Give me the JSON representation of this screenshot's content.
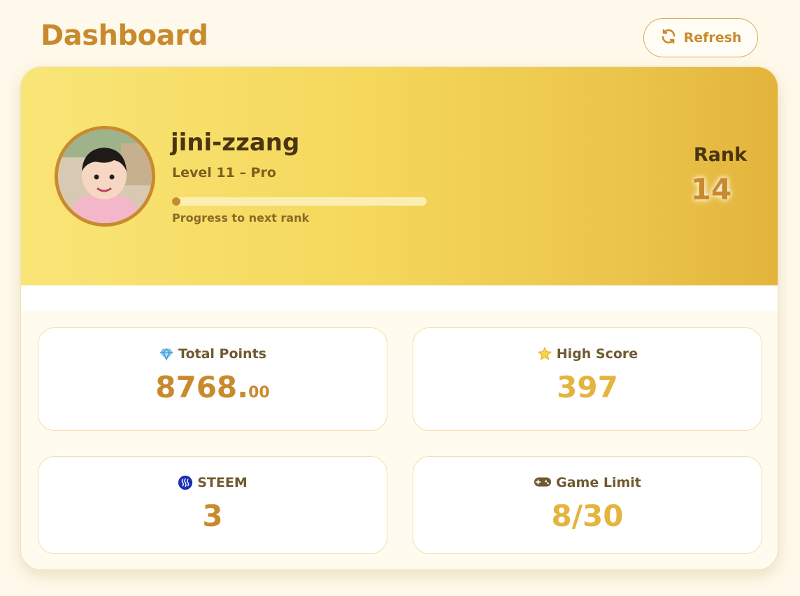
{
  "header": {
    "title": "Dashboard",
    "refresh_label": "Refresh"
  },
  "profile": {
    "username": "jini-zzang",
    "level": "Level 11 – Pro",
    "progress": 0.03,
    "progress_label": "Progress to next rank",
    "rank_label": "Rank",
    "rank_value": "14"
  },
  "stats": {
    "total_points": {
      "label": "Total Points",
      "value_int": "8768.",
      "value_dec": "00",
      "icon": "gem-icon"
    },
    "high_score": {
      "label": "High Score",
      "value": "397",
      "icon": "star-icon"
    },
    "steem": {
      "label": "STEEM",
      "value": "3",
      "icon": "steem-logo-icon"
    },
    "game_limit": {
      "label": "Game Limit",
      "value": "8/30",
      "icon": "gamepad-icon"
    }
  },
  "colors": {
    "accent": "#c98a2e",
    "gold": "#e5b43e",
    "banner_start": "#f9e577",
    "banner_end": "#e3b43b",
    "background": "#fef9ea"
  }
}
